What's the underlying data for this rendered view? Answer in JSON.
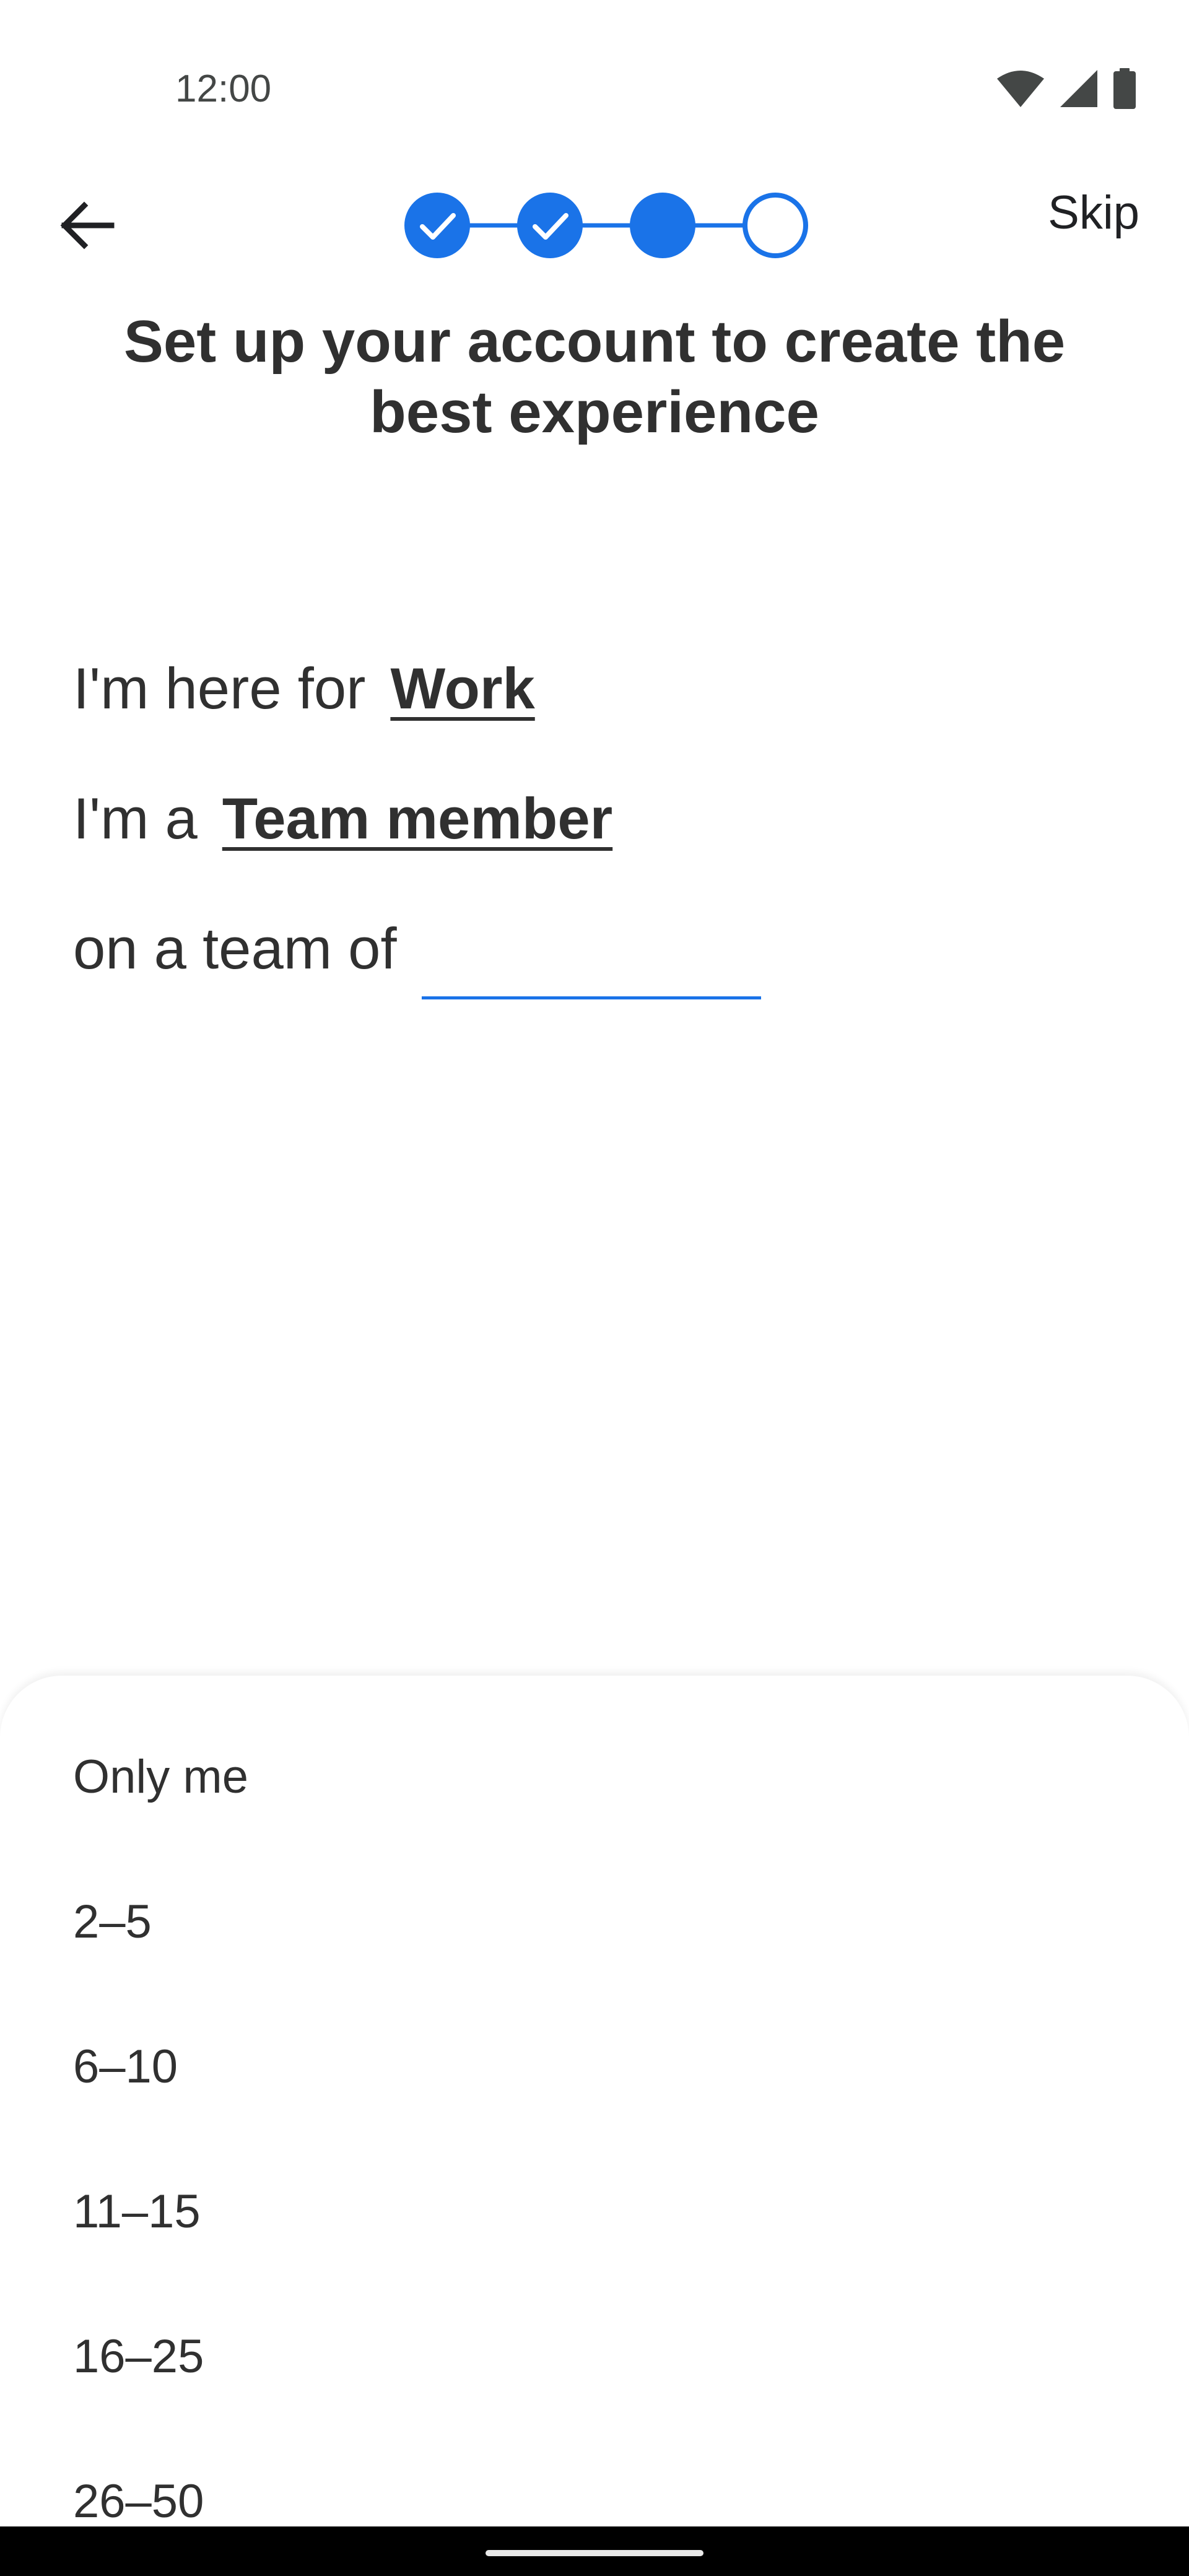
{
  "status_bar": {
    "time": "12:00",
    "icons": [
      "wifi-icon",
      "signal-icon",
      "battery-icon"
    ]
  },
  "toolbar": {
    "back_icon": "arrow-back-icon",
    "skip_label": "Skip",
    "progress_steps": [
      {
        "state": "complete",
        "icon": "check-icon"
      },
      {
        "state": "complete",
        "icon": "check-icon"
      },
      {
        "state": "current"
      },
      {
        "state": "upcoming"
      }
    ]
  },
  "title": "Set up your account to create the best experience",
  "sentence": {
    "purpose": {
      "prefix": "I'm here for",
      "value": "Work"
    },
    "role": {
      "prefix": "I'm a",
      "value": "Team member"
    },
    "team": {
      "prefix": "on a team of",
      "value": ""
    }
  },
  "team_size_options": [
    "Only me",
    "2–5",
    "6–10",
    "11–15",
    "16–25",
    "26–50"
  ],
  "colors": {
    "accent": "#1a73e8",
    "text": "#303030",
    "background": "#ffffff",
    "nav_bar": "#000000"
  }
}
